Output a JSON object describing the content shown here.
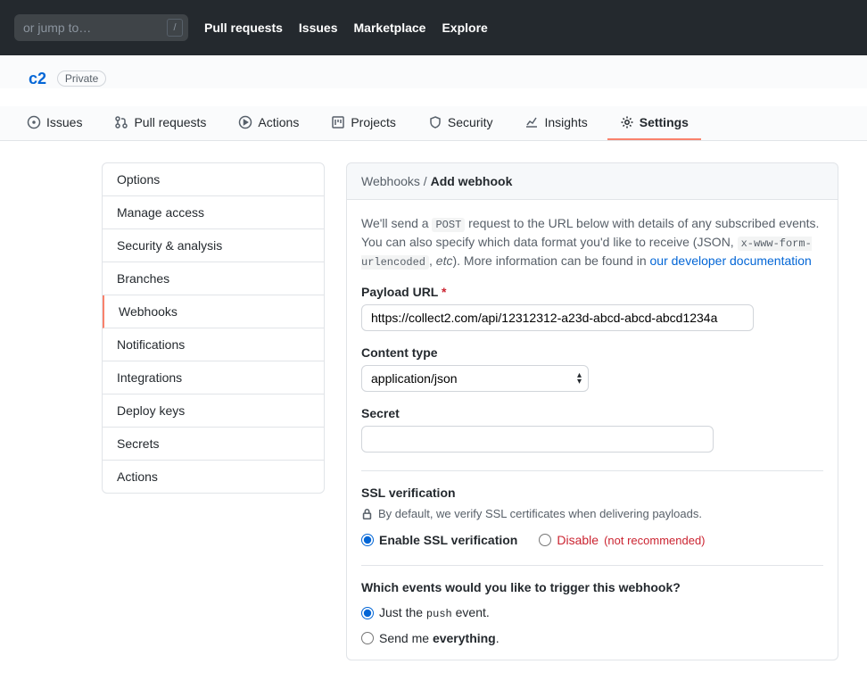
{
  "header": {
    "search_placeholder": "or jump to…",
    "nav": [
      "Pull requests",
      "Issues",
      "Marketplace",
      "Explore"
    ]
  },
  "repo": {
    "name": "c2",
    "visibility": "Private"
  },
  "tabs": [
    {
      "label": "Issues",
      "icon": "issue"
    },
    {
      "label": "Pull requests",
      "icon": "pr"
    },
    {
      "label": "Actions",
      "icon": "play"
    },
    {
      "label": "Projects",
      "icon": "project"
    },
    {
      "label": "Security",
      "icon": "shield"
    },
    {
      "label": "Insights",
      "icon": "graph"
    },
    {
      "label": "Settings",
      "icon": "gear",
      "active": true
    }
  ],
  "sidebar": {
    "items": [
      "Options",
      "Manage access",
      "Security & analysis",
      "Branches",
      "Webhooks",
      "Notifications",
      "Integrations",
      "Deploy keys",
      "Secrets",
      "Actions"
    ],
    "active": "Webhooks"
  },
  "panel": {
    "breadcrumb_parent": "Webhooks",
    "breadcrumb_sep": " / ",
    "breadcrumb_current": "Add webhook",
    "desc_pre": "We'll send a ",
    "desc_code1": "POST",
    "desc_mid1": " request to the URL below with details of any subscribed events. You can also specify which data format you'd like to receive (JSON, ",
    "desc_code2": "x-www-form-urlencoded",
    "desc_mid2": ", ",
    "desc_etc": "etc",
    "desc_mid3": "). More information can be found in ",
    "desc_link": "our developer documentation",
    "payload_label": "Payload URL",
    "payload_value": "https://collect2.com/api/12312312-a23d-abcd-abcd-abcd1234a",
    "content_type_label": "Content type",
    "content_type_value": "application/json",
    "secret_label": "Secret",
    "ssl_heading": "SSL verification",
    "ssl_lock_text": "By default, we verify SSL certificates when delivering payloads.",
    "ssl_enable": "Enable SSL verification",
    "ssl_disable": "Disable",
    "ssl_disable_note": "(not recommended)",
    "events_heading": "Which events would you like to trigger this webhook?",
    "event_just_pre": "Just the ",
    "event_just_code": "push",
    "event_just_post": " event.",
    "event_everything_pre": "Send me ",
    "event_everything_strong": "everything",
    "event_everything_post": "."
  }
}
